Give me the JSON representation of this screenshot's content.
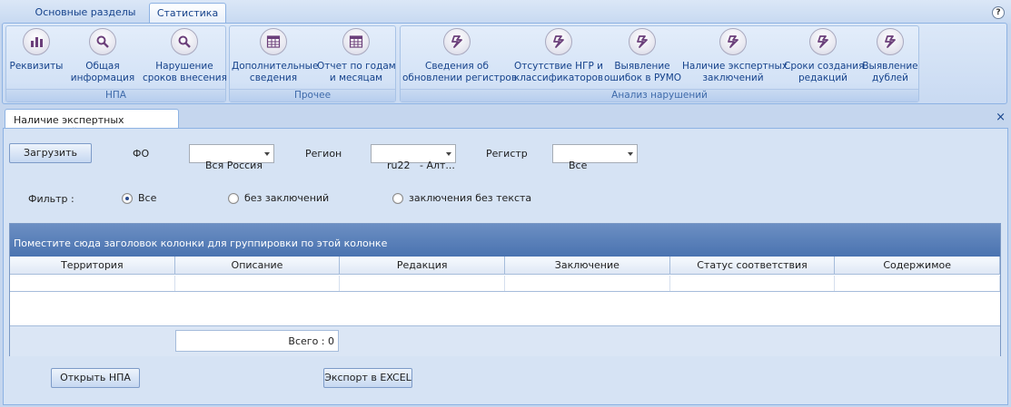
{
  "top_tabs": [
    {
      "label": "Основные разделы",
      "active": false
    },
    {
      "label": "Статистика",
      "active": true
    }
  ],
  "help_label": "?",
  "ribbon": {
    "groups": [
      {
        "caption": "НПА",
        "buttons": [
          {
            "label": "Реквизиты",
            "icon": "bar-chart-icon"
          },
          {
            "label": "Общая\nинформация",
            "icon": "magnifier-icon"
          },
          {
            "label": "Нарушение\nсроков внесения",
            "icon": "magnifier-icon"
          }
        ]
      },
      {
        "caption": "Прочее",
        "buttons": [
          {
            "label": "Дополнительные\nсведения",
            "icon": "table-icon"
          },
          {
            "label": "Отчет по годам\nи месяцам",
            "icon": "table-icon"
          }
        ]
      },
      {
        "caption": "Анализ нарушений",
        "buttons": [
          {
            "label": "Сведения об\nобновлении регистров",
            "icon": "lightning-icon"
          },
          {
            "label": "Отсутствие НГР и\nклассификаторов",
            "icon": "lightning-icon"
          },
          {
            "label": "Выявление\nошибок в РУМО",
            "icon": "lightning-icon"
          },
          {
            "label": "Наличие экспертных\nзаключений",
            "icon": "lightning-icon"
          },
          {
            "label": "Сроки создания\nредакций",
            "icon": "lightning-icon"
          },
          {
            "label": "Выявление\nдублей",
            "icon": "lightning-icon"
          }
        ]
      }
    ]
  },
  "doc_tab": {
    "label": "Наличие экспертных заключений",
    "close": "×"
  },
  "form": {
    "load_button": "Загрузить",
    "fo_label": "ФО",
    "fo_value": "Вся Россия",
    "region_label": "Регион",
    "region_value": "ru22   - Алт...",
    "registry_label": "Регистр",
    "registry_value": "Все",
    "filter_label": "Фильтр :",
    "filter_options": [
      {
        "label": "Все",
        "selected": true
      },
      {
        "label": "без заключений",
        "selected": false
      },
      {
        "label": "заключения без текста",
        "selected": false
      }
    ]
  },
  "grid": {
    "group_panel_text": "Поместите сюда заголовок колонки для группировки по этой колонке",
    "columns": [
      "Территория",
      "Описание",
      "Редакция",
      "Заключение",
      "Статус соответствия",
      "Содержимое"
    ],
    "total_text": "Всего : 0"
  },
  "actions": {
    "open_npa": "Открыть НПА",
    "export_excel": "Экспорт в EXCEL"
  }
}
